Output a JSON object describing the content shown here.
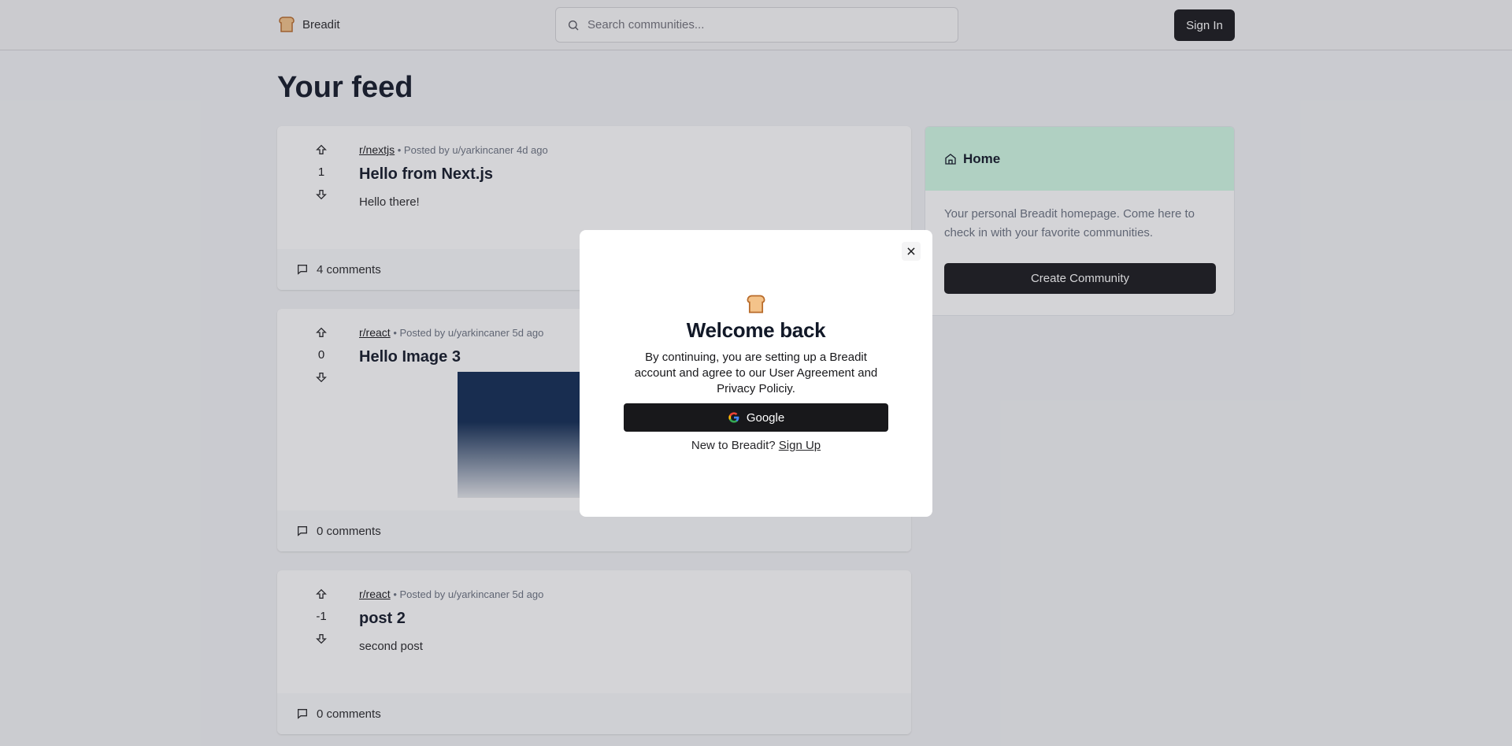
{
  "header": {
    "brand": "Breadit",
    "search_placeholder": "Search communities...",
    "signin_label": "Sign In"
  },
  "page": {
    "title": "Your feed"
  },
  "posts": [
    {
      "subreddit": "r/nextjs",
      "meta": "• Posted by u/yarkincaner 4d ago",
      "score": "1",
      "title": "Hello from Next.js",
      "text": "Hello there!",
      "comments": "4 comments"
    },
    {
      "subreddit": "r/react",
      "meta": "• Posted by u/yarkincaner 5d ago",
      "score": "0",
      "title": "Hello Image 3",
      "text": "",
      "comments": "0 comments"
    },
    {
      "subreddit": "r/react",
      "meta": "• Posted by u/yarkincaner 5d ago",
      "score": "-1",
      "title": "post 2",
      "text": "second post",
      "comments": "0 comments"
    }
  ],
  "sidebar": {
    "title": "Home",
    "description": "Your personal Breadit homepage. Come here to check in with your favorite communities.",
    "create_label": "Create Community"
  },
  "modal": {
    "title": "Welcome back",
    "text": "By continuing, you are setting up a Breadit account and agree to our User Agreement and Privacy Policiy.",
    "google_label": "Google",
    "footer_text": "New to Breadit?",
    "signup_label": "Sign Up"
  },
  "colors": {
    "primary": "#18181b",
    "home_header": "#d1fae5",
    "bread": "#f4c38a"
  }
}
